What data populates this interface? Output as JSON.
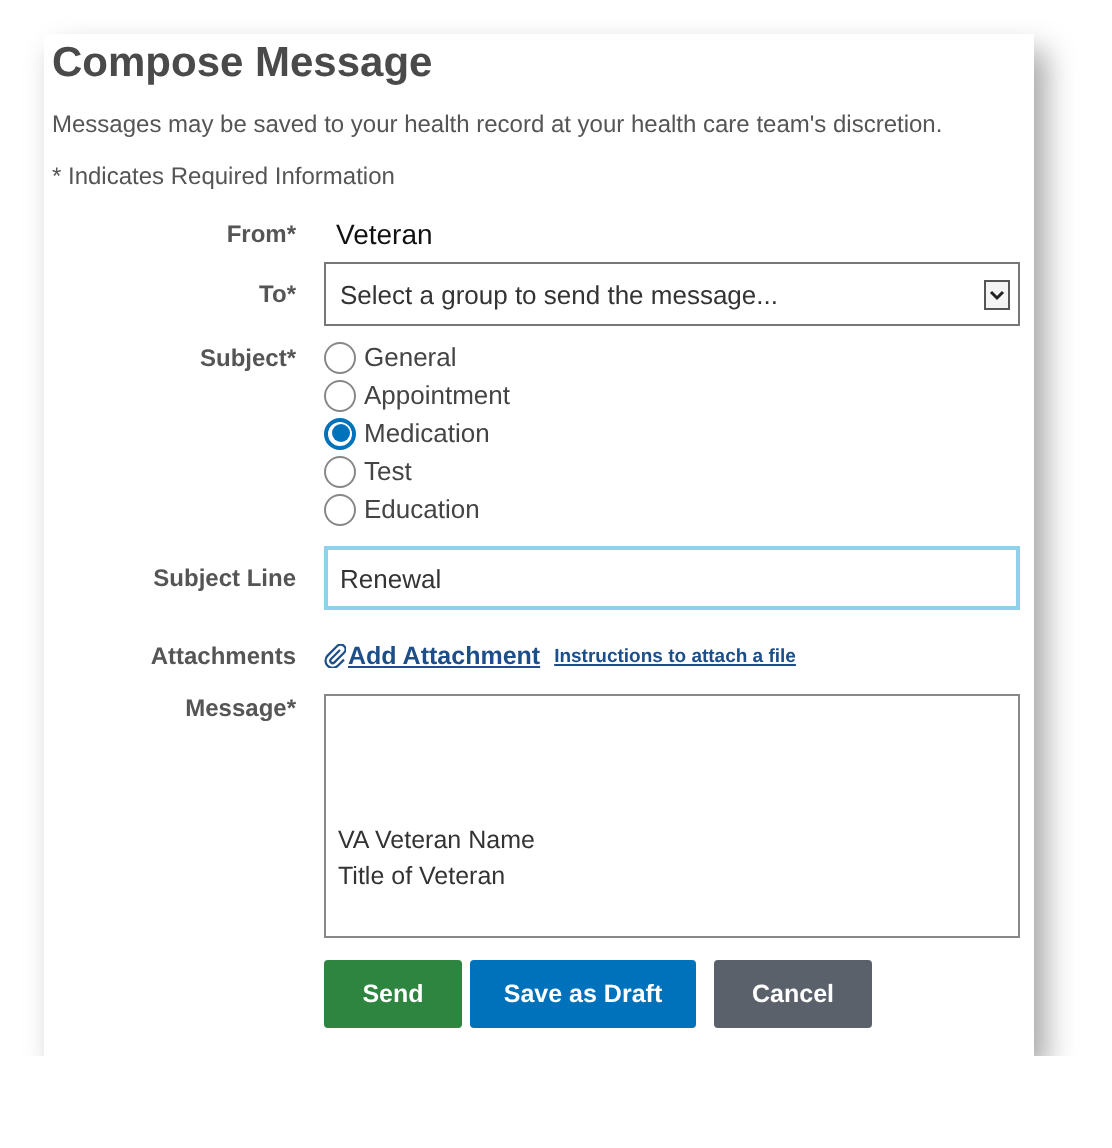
{
  "title": "Compose Message",
  "notice": "Messages may be saved to your health record at your health care team's discretion.",
  "required_note": "* Indicates Required Information",
  "from": {
    "label": "From*",
    "value": "Veteran"
  },
  "to": {
    "label": "To*",
    "placeholder": "Select a group to send the message..."
  },
  "subject": {
    "label": "Subject*",
    "options": [
      {
        "label": "General",
        "selected": false
      },
      {
        "label": "Appointment",
        "selected": false
      },
      {
        "label": "Medication",
        "selected": true
      },
      {
        "label": "Test",
        "selected": false
      },
      {
        "label": "Education",
        "selected": false
      }
    ]
  },
  "subject_line": {
    "label": "Subject Line",
    "value": "Renewal",
    "focused": true
  },
  "attachments": {
    "label": "Attachments",
    "add_link": "Add Attachment",
    "instructions_link": "Instructions to attach a file"
  },
  "message": {
    "label": "Message*",
    "value": "VA Veteran Name\nTitle of Veteran"
  },
  "buttons": [
    {
      "label": "Send",
      "kind": "send"
    },
    {
      "label": "Save as Draft",
      "kind": "draft"
    },
    {
      "label": "Cancel",
      "kind": "cancel"
    }
  ]
}
